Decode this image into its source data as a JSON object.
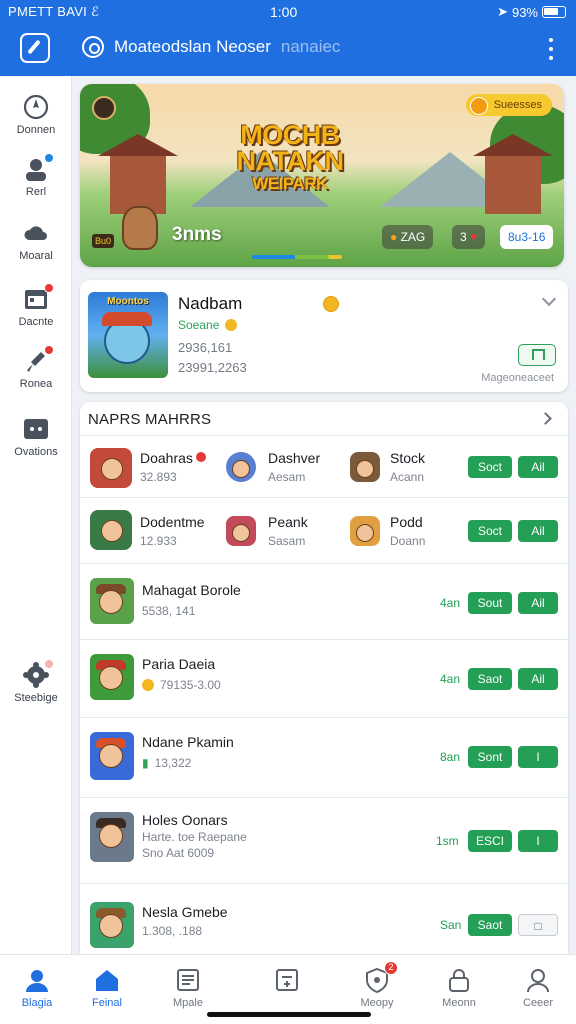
{
  "status": {
    "carrier": "PMETT BAVI ℰ",
    "time": "1:00",
    "battery": "93%"
  },
  "header": {
    "title": "Moateodslan Neoser",
    "subtitle": "nanaiec"
  },
  "sidebar": {
    "items": [
      {
        "label": "Donnen",
        "icon": "compass-icon",
        "badge": false
      },
      {
        "label": "Rerl",
        "icon": "user-icon",
        "badge": "blue"
      },
      {
        "label": "Moaral",
        "icon": "cloud-icon",
        "badge": false
      },
      {
        "label": "Dacnte",
        "icon": "calendar-icon",
        "badge": "red"
      },
      {
        "label": "Ronea",
        "icon": "rocket-icon",
        "badge": "red"
      },
      {
        "label": "Ovations",
        "icon": "gamepad-icon",
        "badge": false
      },
      {
        "label": "Steebige",
        "icon": "settings-icon",
        "badge": "red"
      }
    ]
  },
  "hero": {
    "title_line1": "MOCHB",
    "title_line2": "NATAKN",
    "title_line3": "WEIPARK",
    "pill": "Sueesses",
    "count": "3nms",
    "mascot_tag": "Bu0",
    "chip1": "ZAG",
    "chip2": "3",
    "chip3": "8u3-16",
    "progress_ticks": "'''"
  },
  "featured": {
    "thumb_label": "Moontos",
    "name": "Nadbam",
    "sub": "Soeane",
    "line1": "2936,161",
    "line2": "23991,2263",
    "footer": "Mageoneaceet"
  },
  "list": {
    "title": "NAPRS MAHRRS",
    "pair_rows": [
      {
        "items": [
          {
            "title": "Doahras",
            "sub": "32.893"
          },
          {
            "title": "Dashver",
            "sub": "Aesam"
          },
          {
            "title": "Stock",
            "sub": "Acann"
          }
        ],
        "btn1": "Soct",
        "btn2": "Ail"
      },
      {
        "items": [
          {
            "title": "Dodentme",
            "sub": "12.933"
          },
          {
            "title": "Peank",
            "sub": "Sasam"
          },
          {
            "title": "Podd",
            "sub": "Doann"
          }
        ],
        "btn1": "Soct",
        "btn2": "Ail"
      }
    ],
    "rows": [
      {
        "title": "Mahagat Borole",
        "sub": "5538, 141",
        "sub2": "",
        "rank": "4an",
        "btn1": "Sout",
        "btn2": "Ail"
      },
      {
        "title": "Paria Daeia",
        "sub": "79135-3.00",
        "sub2": "",
        "rank": "4an",
        "btn1": "Saot",
        "btn2": "Ail"
      },
      {
        "title": "Ndane Pkamin",
        "sub": "13,322",
        "sub2": "",
        "rank": "8an",
        "btn1": "Sont",
        "btn2": "I"
      },
      {
        "title": "Holes Oonars",
        "sub": "Harte. toe Raepane",
        "sub2": "Sno Aat 6009",
        "rank": "1sm",
        "btn1": "ESCI",
        "btn2": "I"
      },
      {
        "title": "Nesla Gmebe",
        "sub": "1.308, .188",
        "sub2": "",
        "rank": "San",
        "btn1": "Saot",
        "btn2": ""
      }
    ]
  },
  "bottom_nav": [
    {
      "label": "Blagia",
      "icon": "profile-icon"
    },
    {
      "label": "Feinal",
      "icon": "home-icon"
    },
    {
      "label": "Mpale",
      "icon": "news-icon"
    },
    {
      "label": "",
      "icon": "calculator-icon"
    },
    {
      "label": "Meopy",
      "icon": "shield-icon",
      "badge": "2"
    },
    {
      "label": "Meonn",
      "icon": "lock-icon"
    },
    {
      "label": "Ceeer",
      "icon": "person-icon"
    }
  ],
  "colors": {
    "primary": "#1f6fe0",
    "green": "#23a055",
    "badge_red": "#e53935"
  }
}
